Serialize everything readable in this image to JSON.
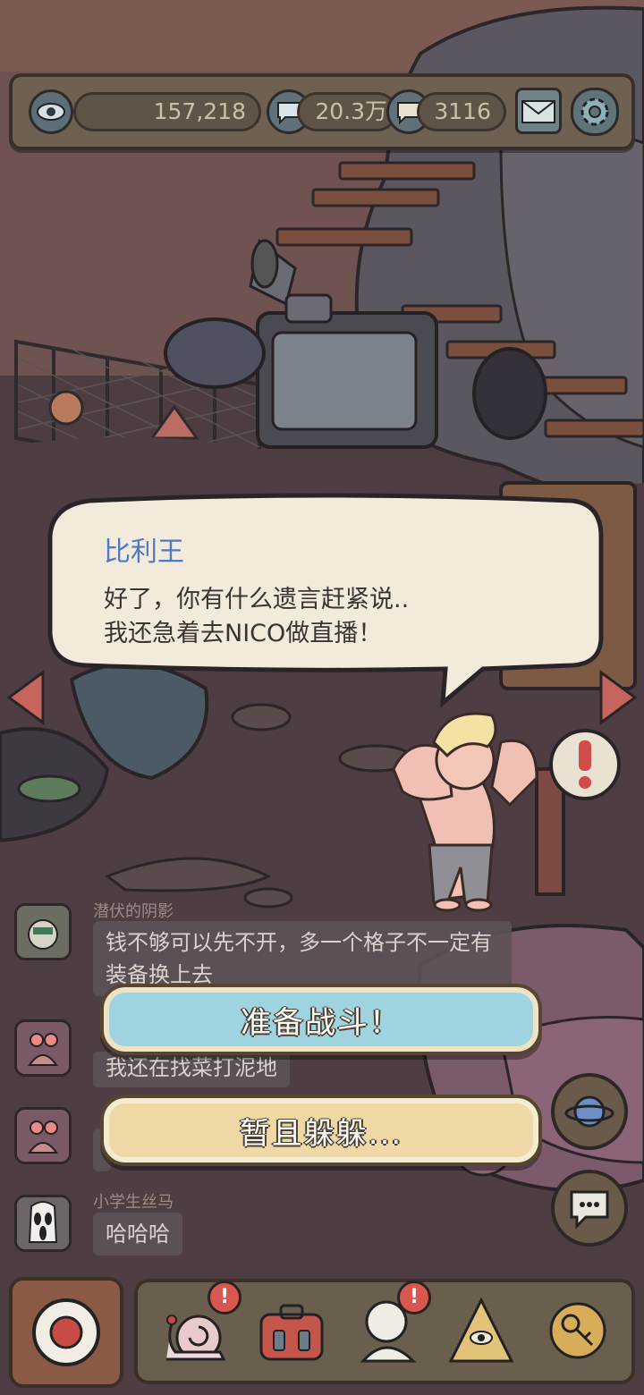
{
  "topbar": {
    "views_count": "157,218",
    "comments_count": "20.3万",
    "fans_count": "3116"
  },
  "dialogue": {
    "speaker": "比利王",
    "line1": "好了，你有什么遗言赶紧说..",
    "line2": "我还急着去NICO做直播！"
  },
  "chat": [
    {
      "name": "潜伏的阴影",
      "message_line1": "钱不够可以先不开，多一个格子不一定有",
      "message_line2": "装备换上去"
    },
    {
      "name": "",
      "message": "我还在找菜打泥地"
    },
    {
      "name": "",
      "message": ""
    },
    {
      "name": "小学生丝马",
      "message": "哈哈哈"
    }
  ],
  "actions": {
    "fight_label": "准备战斗！",
    "hide_label": "暂且躲躲..."
  },
  "colors": {
    "fight_button": "#9fd3df",
    "hide_button": "#eed9a6",
    "speaker_name": "#4f78c6",
    "alert": "#d8584f"
  }
}
